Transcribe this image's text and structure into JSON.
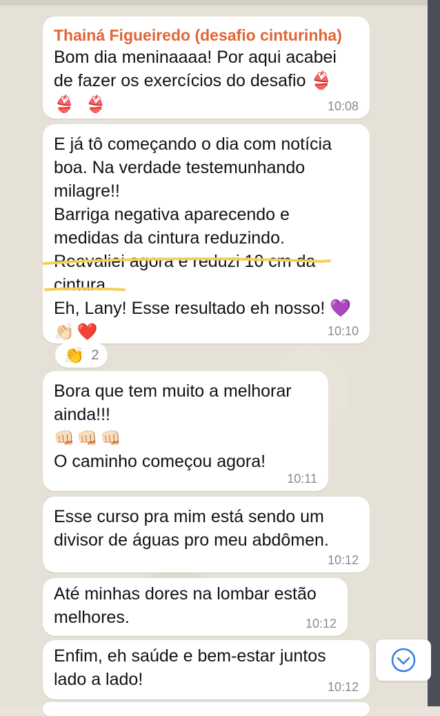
{
  "messages": [
    {
      "sender": "Thainá Figueiredo (desafio cinturinha)",
      "lines": [
        "Bom dia meninaaaa! Por aqui acabei",
        "de fazer os exercícios do desafio 👙",
        "👙 👙"
      ],
      "time": "10:08"
    },
    {
      "lines": [
        "E já tô começando o dia com notícia",
        "boa. Na verdade testemunhando",
        "milagre!!",
        "Barriga negativa aparecendo e",
        "medidas da cintura reduzindo.",
        "Reavaliei agora e reduzi 10 cm da",
        "cintura.",
        "Eh, Lany! Esse resultado eh nosso! 💜",
        "👏🏻❤️"
      ],
      "time": "10:10",
      "reaction": {
        "emoji": "👏",
        "count": "2"
      }
    },
    {
      "lines": [
        "Bora que tem muito a melhorar",
        "ainda!!!",
        "👊🏻👊🏻👊🏻",
        "O caminho começou agora!"
      ],
      "time": "10:11"
    },
    {
      "lines": [
        "Esse curso pra mim está sendo um",
        "divisor de águas pro meu abdômen."
      ],
      "time": "10:12"
    },
    {
      "lines": [
        "Até minhas dores na lombar estão",
        "melhores."
      ],
      "time": "10:12"
    },
    {
      "lines": [
        "Enfim, eh saúde e bem-estar juntos",
        "lado a lado!"
      ],
      "time": "10:12"
    }
  ],
  "icons": {
    "scroll_down": "chevron-down-circle-icon",
    "highlight_color": "#f3cf55",
    "accent_color": "#2f7fe0",
    "sender_color": "#e06535"
  }
}
